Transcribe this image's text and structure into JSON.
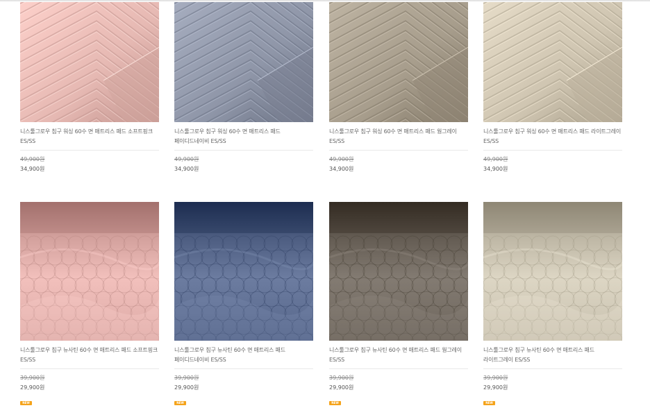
{
  "products": [
    {
      "name": "니스툴그로우 침구 워싱 60수 면 매트리스 패드 소프트핑크 ES/SS",
      "original_price": "49,900원",
      "sale_price": "34,900원",
      "color": "#e6b9b3",
      "pattern": "chevron",
      "badge": ""
    },
    {
      "name": "니스툴그로우 침구 워싱 60수 면 매트리스 패드 페이디드네이비 ES/SS",
      "original_price": "49,900원",
      "sale_price": "34,900원",
      "color": "#8f96a8",
      "pattern": "chevron",
      "badge": ""
    },
    {
      "name": "니스툴그로우 침구 워싱 60수 면 매트리스 패드 웜그레이 ES/SS",
      "original_price": "49,900원",
      "sale_price": "34,900원",
      "color": "#a79d8c",
      "pattern": "chevron",
      "badge": ""
    },
    {
      "name": "니스툴그로우 침구 워싱 60수 면 매트리스 패드 라이트그레이 ES/SS",
      "original_price": "49,900원",
      "sale_price": "34,900원",
      "color": "#cfc5b1",
      "pattern": "chevron",
      "badge": ""
    },
    {
      "name": "니스툴그로우 침구 뉴사틴 60수 면 매트리스 패드 소프트핑크 ES/SS",
      "original_price": "39,900원",
      "sale_price": "29,900원",
      "color": "#dcaaa6",
      "pattern": "quilt",
      "badge": "NEW"
    },
    {
      "name": "니스툴그로우 침구 뉴사틴 60수 면 매트리스 패드 페이디드네이비 ES/SS",
      "original_price": "39,900원",
      "sale_price": "29,900원",
      "color": "#56668a",
      "pattern": "quilt",
      "badge": "NEW"
    },
    {
      "name": "니스툴그로우 침구 뉴사틴 60수 면 매트리스 패드 웜그레이 ES/SS",
      "original_price": "39,900원",
      "sale_price": "29,900원",
      "color": "#6d655c",
      "pattern": "quilt",
      "badge": "NEW"
    },
    {
      "name": "니스툴그로우 침구 뉴사틴 60수 면 매트리스 패드 라이트그레이 ES/SS",
      "original_price": "39,900원",
      "sale_price": "29,900원",
      "color": "#c7c0ae",
      "pattern": "quilt",
      "badge": "NEW"
    }
  ]
}
